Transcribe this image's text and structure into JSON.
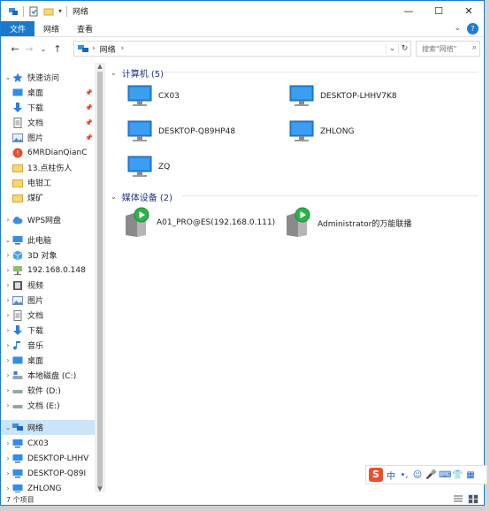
{
  "window": {
    "title": "网络",
    "controls": [
      "—",
      "☐",
      "✕"
    ]
  },
  "ribbon": {
    "tabs": [
      "文件",
      "网络",
      "查看"
    ]
  },
  "address": {
    "path_label": "网络",
    "separator": "›",
    "search_placeholder": "搜索\"网络\""
  },
  "nav": {
    "quick_access": "快速访问",
    "quick_items": [
      {
        "label": "桌面",
        "pinned": true
      },
      {
        "label": "下载",
        "pinned": true
      },
      {
        "label": "文档",
        "pinned": true
      },
      {
        "label": "图片",
        "pinned": true
      },
      {
        "label": "6MRDianQianC",
        "pinned": false
      },
      {
        "label": "13.点柱伤人",
        "pinned": false
      },
      {
        "label": "电钳工",
        "pinned": false
      },
      {
        "label": "煤矿",
        "pinned": false
      }
    ],
    "wps": "WPS网盘",
    "this_pc": "此电脑",
    "pc_items": [
      "3D 对象",
      "192.168.0.148",
      "视频",
      "图片",
      "文档",
      "下载",
      "音乐",
      "桌面",
      "本地磁盘 (C:)",
      "软件 (D:)",
      "文档 (E:)"
    ],
    "network": "网络",
    "network_items": [
      "CX03",
      "DESKTOP-LHHV",
      "DESKTOP-Q89I",
      "ZHLONG"
    ]
  },
  "content": {
    "computers_group": "计算机 (5)",
    "computers": [
      "CX03",
      "DESKTOP-LHHV7K8",
      "DESKTOP-Q89HP48",
      "ZHLONG",
      "ZQ"
    ],
    "media_group": "媒体设备 (2)",
    "media": [
      "A01_PRO@ES(192.168.0.111)",
      "Administrator的万能联播"
    ]
  },
  "status": {
    "count": "7 个项目"
  },
  "ime": {
    "logo": "S",
    "mode": "中"
  },
  "colors": {
    "accent": "#1979ca",
    "group_title": "#1e3287",
    "selected": "#cce4f7",
    "media_green": "#2db34a"
  }
}
